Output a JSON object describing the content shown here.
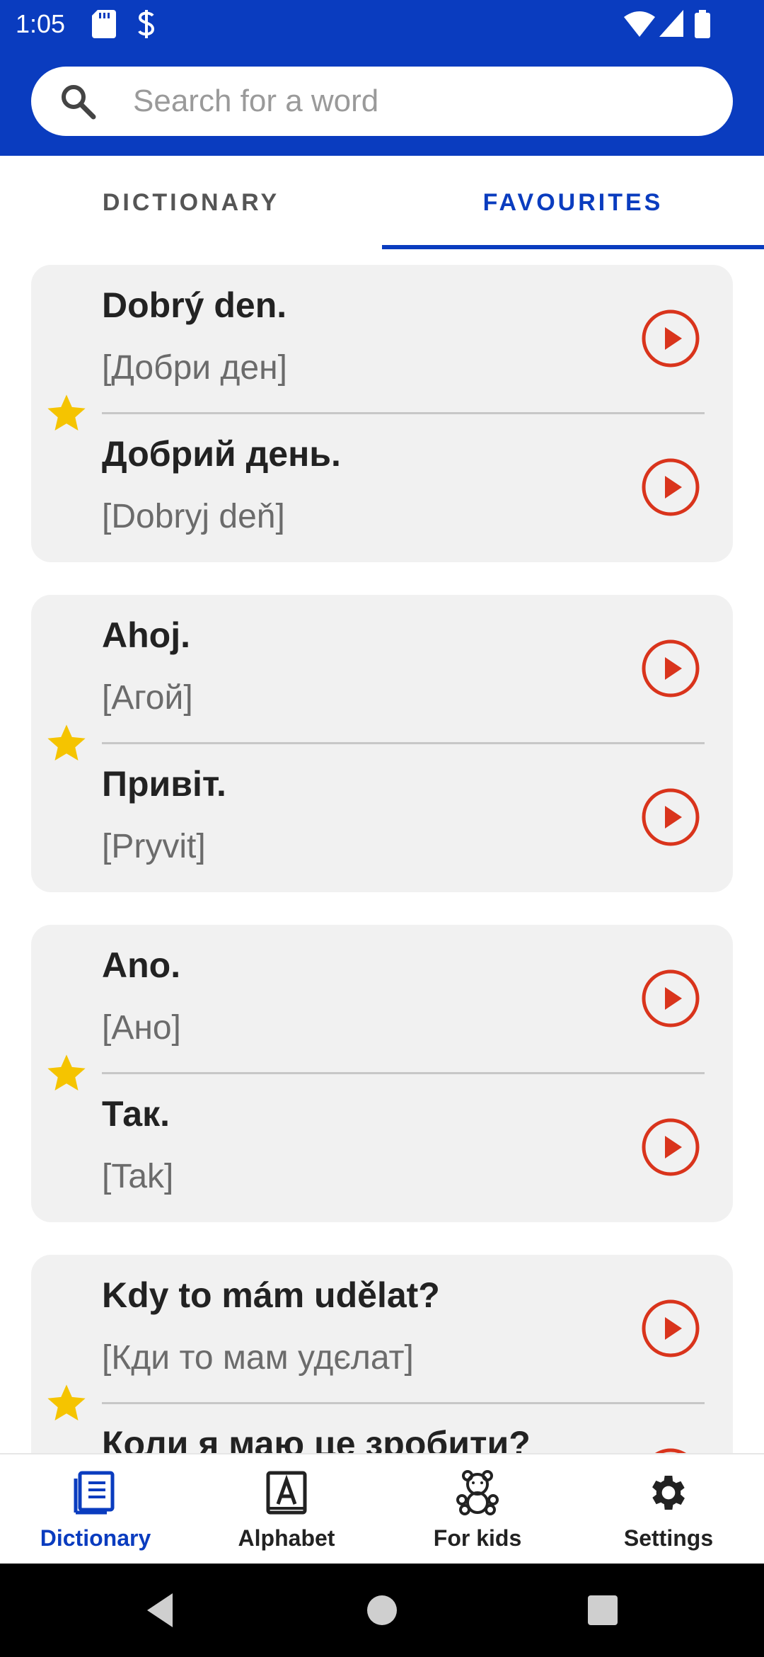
{
  "status_bar": {
    "time": "1:05"
  },
  "search": {
    "placeholder": "Search for a word"
  },
  "tabs": [
    {
      "label": "DICTIONARY",
      "selected": false
    },
    {
      "label": "FAVOURITES",
      "selected": true
    }
  ],
  "favourites": [
    {
      "starred": true,
      "top": {
        "phrase": "Dobrý den.",
        "transliteration": "[Добри ден]"
      },
      "bottom": {
        "phrase": "Добрий день.",
        "transliteration": "[Dobryj deň]"
      }
    },
    {
      "starred": true,
      "top": {
        "phrase": "Ahoj.",
        "transliteration": "[Агой]"
      },
      "bottom": {
        "phrase": "Привіт.",
        "transliteration": "[Pryvit]"
      }
    },
    {
      "starred": true,
      "top": {
        "phrase": "Ano.",
        "transliteration": "[Ано]"
      },
      "bottom": {
        "phrase": "Так.",
        "transliteration": "[Tak]"
      }
    },
    {
      "starred": true,
      "top": {
        "phrase": "Kdy to mám udělat?",
        "transliteration": "[Кди то мам удєлат]"
      },
      "bottom": {
        "phrase": "Коли я маю це зробити?",
        "transliteration": ""
      }
    }
  ],
  "bottom_nav": [
    {
      "label": "Dictionary",
      "icon": "book-icon",
      "active": true
    },
    {
      "label": "Alphabet",
      "icon": "alphabet-icon",
      "active": false
    },
    {
      "label": "For kids",
      "icon": "teddy-bear-icon",
      "active": false
    },
    {
      "label": "Settings",
      "icon": "gear-icon",
      "active": false
    }
  ],
  "colors": {
    "primary": "#0a3cbf",
    "star": "#f5c400",
    "play": "#d9341c",
    "card_bg": "#f1f1f1"
  }
}
